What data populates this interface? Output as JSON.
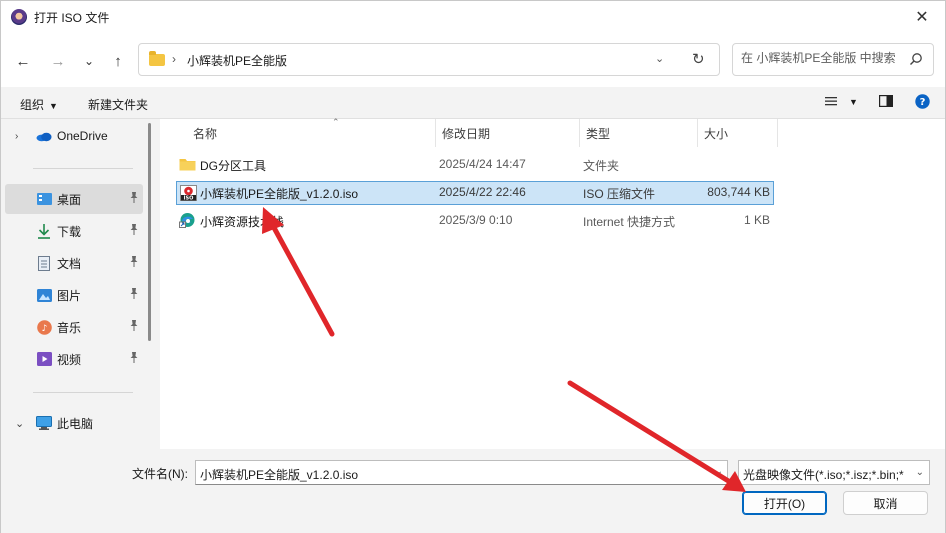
{
  "window": {
    "title": "打开 ISO 文件",
    "close_glyph": "✕"
  },
  "nav": {
    "back": "←",
    "forward": "→",
    "recent": "⌄",
    "up": "↑",
    "path_separator": "›",
    "path": "小辉装机PE全能版",
    "refresh": "↻",
    "path_dropdown": "⌄",
    "search_placeholder": "在 小辉装机PE全能版 中搜索"
  },
  "toolbar": {
    "organize": "组织",
    "new_folder": "新建文件夹",
    "caret": "▼",
    "view_icon": "view-list-icon",
    "pane_icon": "preview-pane-icon",
    "help_icon": "help-icon"
  },
  "sidebar": {
    "items": [
      {
        "label": "OneDrive",
        "icon": "onedrive-icon",
        "chevron": "›",
        "pinned": false
      },
      {
        "label": "桌面",
        "icon": "desktop-icon",
        "pinned": true,
        "selected": true
      },
      {
        "label": "下载",
        "icon": "download-icon",
        "pinned": true
      },
      {
        "label": "文档",
        "icon": "documents-icon",
        "pinned": true
      },
      {
        "label": "图片",
        "icon": "pictures-icon",
        "pinned": true
      },
      {
        "label": "音乐",
        "icon": "music-icon",
        "pinned": true
      },
      {
        "label": "视频",
        "icon": "videos-icon",
        "pinned": true
      },
      {
        "label": "此电脑",
        "icon": "this-pc-icon",
        "chevron": "⌄",
        "pinned": false
      }
    ],
    "pin_glyph": "📌"
  },
  "columns": {
    "name": "名称",
    "modified": "修改日期",
    "type": "类型",
    "size": "大小",
    "sort_glyph": "⌃"
  },
  "files": [
    {
      "name": "DG分区工具",
      "modified": "2025/4/24 14:47",
      "type": "文件夹",
      "size": "",
      "icon": "folder-icon"
    },
    {
      "name": "小辉装机PE全能版_v1.2.0.iso",
      "modified": "2025/4/22 22:46",
      "type": "ISO 压缩文件",
      "size": "803,744 KB",
      "icon": "iso-file-icon",
      "selected": true
    },
    {
      "name": "小辉资源技术栈",
      "modified": "2025/3/9 0:10",
      "type": "Internet 快捷方式",
      "size": "1 KB",
      "icon": "edge-shortcut-icon"
    }
  ],
  "footer": {
    "filename_label": "文件名(N):",
    "filename_value": "小辉装机PE全能版_v1.2.0.iso",
    "filetype_value": "光盘映像文件(*.iso;*.isz;*.bin;*",
    "dropdown_glyph": "⌄",
    "open_label": "打开(O)",
    "cancel_label": "取消"
  },
  "annotation_color": "#e0262a"
}
